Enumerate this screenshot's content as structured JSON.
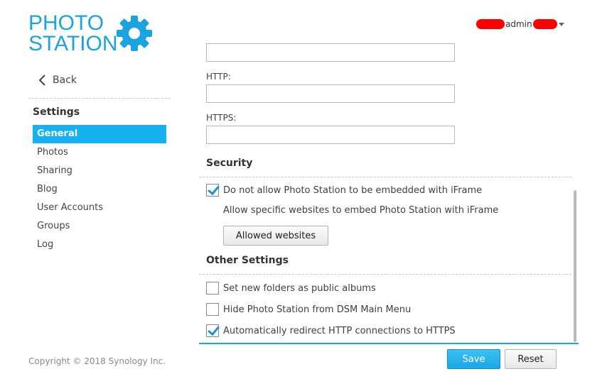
{
  "logo": {
    "line1": "PHOTO",
    "line2": "STATION",
    "color": "#1aa3e0",
    "icon": "gear-icon"
  },
  "user": {
    "name": "admin"
  },
  "sidebar": {
    "back_label": "Back",
    "title": "Settings",
    "items": [
      {
        "label": "General",
        "active": true
      },
      {
        "label": "Photos"
      },
      {
        "label": "Sharing"
      },
      {
        "label": "Blog"
      },
      {
        "label": "User Accounts"
      },
      {
        "label": "Groups"
      },
      {
        "label": "Log"
      }
    ],
    "active_color": "#16b2ef"
  },
  "form": {
    "top_field_value": "",
    "http_label": "HTTP:",
    "http_value": "",
    "https_label": "HTTPS:",
    "https_value": ""
  },
  "security": {
    "title": "Security",
    "iframe_label": "Do not allow Photo Station to be embedded with iFrame",
    "iframe_checked": true,
    "note": "Allow specific websites to embed Photo Station with iFrame",
    "allowed_button": "Allowed websites"
  },
  "other": {
    "title": "Other Settings",
    "options": [
      {
        "label": "Set new folders as public albums",
        "checked": false
      },
      {
        "label": "Hide Photo Station from DSM Main Menu",
        "checked": false
      },
      {
        "label": "Automatically redirect HTTP connections to HTTPS",
        "checked": true
      }
    ]
  },
  "footer": {
    "copyright": "Copyright © 2018 Synology Inc.",
    "save_label": "Save",
    "reset_label": "Reset"
  }
}
